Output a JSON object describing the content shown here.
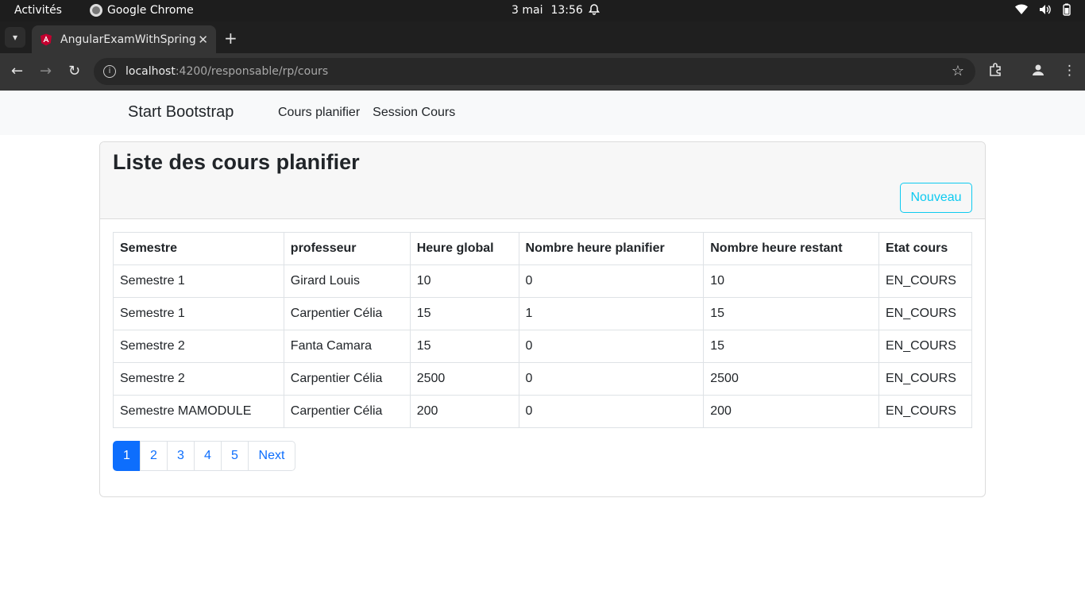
{
  "system_bar": {
    "activities": "Activités",
    "app_name": "Google Chrome",
    "date": "3 mai",
    "time": "13:56"
  },
  "browser": {
    "tab_title": "AngularExamWithSpring",
    "url_host": "localhost",
    "url_path": ":4200/responsable/rp/cours"
  },
  "navbar": {
    "brand": "Start Bootstrap",
    "links": [
      "Cours planifier",
      "Session Cours"
    ]
  },
  "card": {
    "title": "Liste des cours planifier",
    "new_button": "Nouveau"
  },
  "table": {
    "headers": [
      "Semestre",
      "professeur",
      "Heure global",
      "Nombre heure planifier",
      "Nombre heure restant",
      "Etat cours"
    ],
    "rows": [
      [
        "Semestre 1",
        "Girard Louis",
        "10",
        "0",
        "10",
        "EN_COURS"
      ],
      [
        "Semestre 1",
        "Carpentier Célia",
        "15",
        "1",
        "15",
        "EN_COURS"
      ],
      [
        "Semestre 2",
        "Fanta Camara",
        "15",
        "0",
        "15",
        "EN_COURS"
      ],
      [
        "Semestre 2",
        "Carpentier Célia",
        "2500",
        "0",
        "2500",
        "EN_COURS"
      ],
      [
        "Semestre MAMODULE",
        "Carpentier Célia",
        "200",
        "0",
        "200",
        "EN_COURS"
      ]
    ]
  },
  "pagination": {
    "pages": [
      "1",
      "2",
      "3",
      "4",
      "5"
    ],
    "active_page": "1",
    "next_label": "Next"
  },
  "colors": {
    "primary": "#0d6efd",
    "info": "#0dcaf0"
  }
}
